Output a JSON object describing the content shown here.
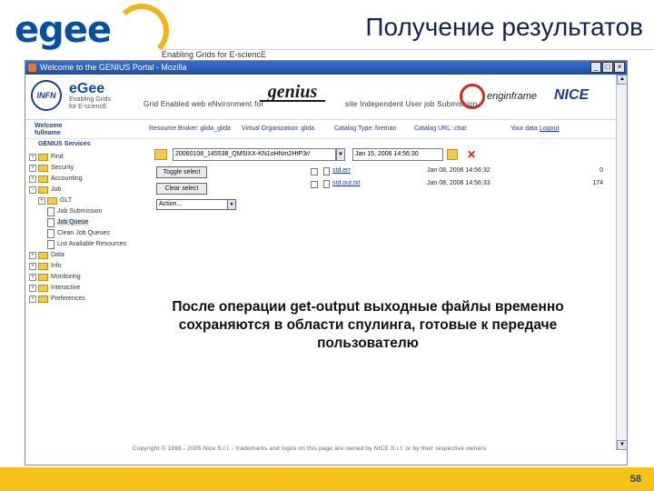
{
  "slide": {
    "title": "Получение результатов",
    "logo_text": "egee",
    "tagline": "Enabling Grids for E-sciencE",
    "page_number": "58",
    "colors": {
      "logo_blue": "#0a4e9e",
      "footer_yellow": "#f5c218",
      "title_navy": "#17234f"
    }
  },
  "browser": {
    "window_title": "Welcome to the GENIUS Portal - Mozilla",
    "window_buttons": [
      "_",
      "□",
      "×"
    ]
  },
  "banner": {
    "infn": "INFN",
    "egee_line1": "eGee",
    "egee_line2": "Enabling Grids for E-sciencE",
    "genius": "genius",
    "grid_env": "Grid Enabled web eNvironment for",
    "site_text": "site Independent User job Submission",
    "enginframe": "enginframe",
    "nice": "NICE"
  },
  "infobar": {
    "welcome_line1": "Welcome",
    "welcome_line2": "fullname",
    "resource_broker": "Resource Broker: glida_glida",
    "vo": "Virtual Organization: glida",
    "catalog_type": "Catalog Type: fireman",
    "catalog_url": "Catalog URL: chat",
    "your_data": "Your data",
    "logout": "Logout"
  },
  "sidebar": {
    "section_title": "GENIUS Services",
    "items": [
      {
        "label": "Find",
        "toggle": "+",
        "icon": "folder-icon"
      },
      {
        "label": "Security",
        "toggle": "+",
        "icon": "folder-icon"
      },
      {
        "label": "Accounting",
        "toggle": "+",
        "icon": "folder-icon"
      },
      {
        "label": "Job",
        "toggle": "−",
        "icon": "folder-icon"
      },
      {
        "label": "GLT",
        "toggle": "+",
        "icon": "folder-icon"
      },
      {
        "label": "Job Submission",
        "toggle": "",
        "icon": "doc-icon"
      },
      {
        "label": "Job Queue",
        "toggle": "",
        "icon": "doc-icon"
      },
      {
        "label": "Clean Job Queues",
        "toggle": "",
        "icon": "doc-icon"
      },
      {
        "label": "List Available Resources",
        "toggle": "",
        "icon": "doc-icon"
      },
      {
        "label": "Data",
        "toggle": "+",
        "icon": "folder-icon"
      },
      {
        "label": "Info",
        "toggle": "+",
        "icon": "folder-icon"
      },
      {
        "label": "Monitoring",
        "toggle": "+",
        "icon": "folder-icon"
      },
      {
        "label": "Interactive",
        "toggle": "+",
        "icon": "folder-icon"
      },
      {
        "label": "Preferences",
        "toggle": "+",
        "icon": "folder-icon"
      }
    ]
  },
  "main": {
    "path_value": "20060108_145538_QM5IXX-KN1oHNm2HtP3r/",
    "date_value": "Jan 15, 2006 14:56:30",
    "toggle_select_label": "Toggle select",
    "clear_select_label": "Clear select",
    "action_select_value": "Action...",
    "files": [
      {
        "name": "std.err",
        "date": "Jan 08, 2006 14:56:32",
        "size": "0"
      },
      {
        "name": "std.out.txt",
        "date": "Jan 08, 2006 14:56:33",
        "size": "174"
      }
    ]
  },
  "copyright": "Copyright © 1998 - 2005 Nice S.r.l. - trademarks and logos on this page are owned by NICE S.r.l. or by their respective owners",
  "callout": {
    "text": "После операции get-output выходные файлы временно сохраняются в области спулинга, готовые к передаче пользователю"
  }
}
